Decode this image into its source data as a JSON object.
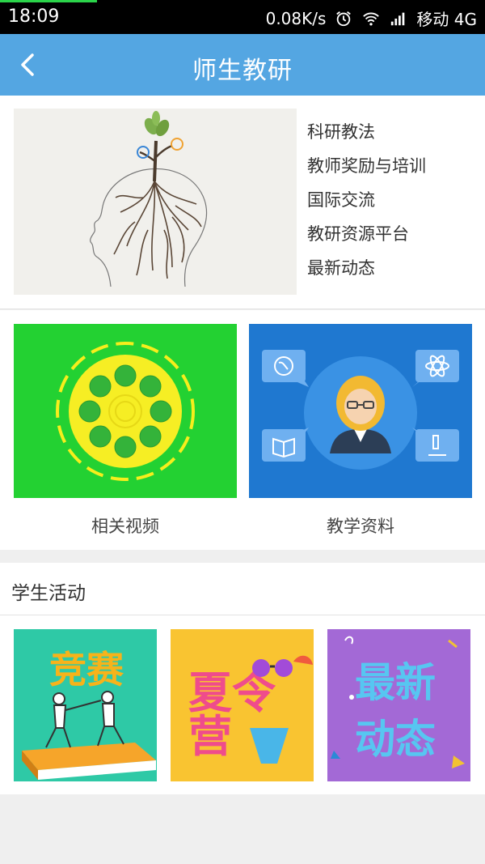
{
  "status_bar": {
    "time": "18:09",
    "network_speed": "0.08K/s",
    "carrier": "移动 4G",
    "icons": [
      "alarm-icon",
      "wifi-icon",
      "signal-icon"
    ]
  },
  "header": {
    "title": "师生教研",
    "back_icon": "chevron-left-icon",
    "color": "#54a6e2"
  },
  "research_links": [
    {
      "label": "科研教法"
    },
    {
      "label": "教师奖励与培训"
    },
    {
      "label": "国际交流"
    },
    {
      "label": "教研资源平台"
    },
    {
      "label": "最新动态"
    }
  ],
  "tiles": {
    "video": {
      "label": "相关视频",
      "color": "#23d132"
    },
    "material": {
      "label": "教学资料",
      "color": "#1f78d0"
    }
  },
  "activities": {
    "title": "学生活动",
    "items": [
      {
        "text": "竞赛",
        "color": "#2ec9a6"
      },
      {
        "text": "夏令营",
        "color": "#f9c431"
      },
      {
        "text_line1": "最新",
        "text_line2": "动态",
        "color": "#a369d6"
      }
    ]
  }
}
